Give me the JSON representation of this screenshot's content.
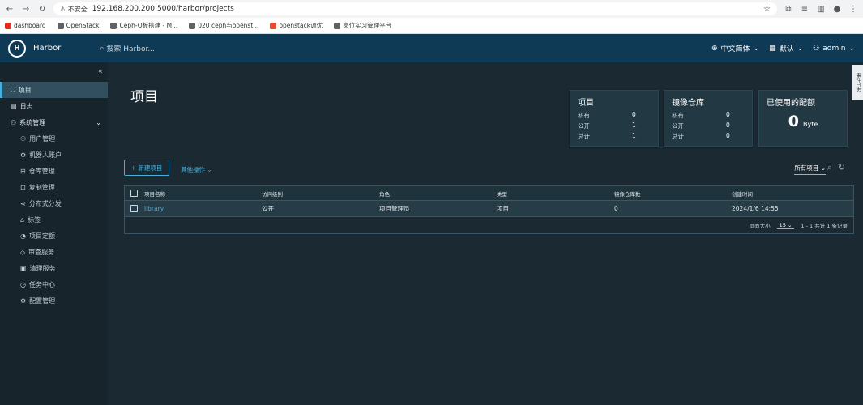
{
  "browser": {
    "security_label": "不安全",
    "url": "192.168.200.200:5000/harbor/projects",
    "bookmarks": [
      {
        "label": "dashboard",
        "color": "#d93025"
      },
      {
        "label": "OpenStack",
        "color": "#5f6368"
      },
      {
        "label": "Ceph-O板搭建 - M...",
        "color": "#5f6368"
      },
      {
        "label": "020 ceph与openst...",
        "color": "#5f6368"
      },
      {
        "label": "openstack调优",
        "color": "#e34a2f"
      },
      {
        "label": "岗位实习管理平台",
        "color": "#5f6368"
      }
    ]
  },
  "header": {
    "logo_glyph": "H",
    "brand": "Harbor",
    "search_placeholder": "搜索 Harbor...",
    "language": "中文简体",
    "theme": "默认",
    "user": "admin"
  },
  "sidebar": {
    "collapse_icon": "«",
    "items": [
      {
        "label": "项目",
        "icon": "⛶"
      },
      {
        "label": "日志",
        "icon": "▤"
      },
      {
        "label": "系统管理",
        "icon": "⚇"
      }
    ],
    "admin_items": [
      {
        "label": "用户管理",
        "icon": "⚇"
      },
      {
        "label": "机器人账户",
        "icon": "⚙"
      },
      {
        "label": "仓库管理",
        "icon": "⊞"
      },
      {
        "label": "复制管理",
        "icon": "⊡"
      },
      {
        "label": "分布式分发",
        "icon": "⋖"
      },
      {
        "label": "标签",
        "icon": "⌂"
      },
      {
        "label": "项目定额",
        "icon": "◔"
      },
      {
        "label": "审查服务",
        "icon": "◇"
      },
      {
        "label": "清理服务",
        "icon": "▣"
      },
      {
        "label": "任务中心",
        "icon": "◷"
      },
      {
        "label": "配置管理",
        "icon": "⚙"
      }
    ]
  },
  "page": {
    "title": "项目"
  },
  "cards": {
    "projects": {
      "title": "项目",
      "rows": [
        {
          "label": "私有",
          "value": "0"
        },
        {
          "label": "公开",
          "value": "1"
        },
        {
          "label": "总计",
          "value": "1"
        }
      ]
    },
    "repos": {
      "title": "镜像仓库",
      "rows": [
        {
          "label": "私有",
          "value": "0"
        },
        {
          "label": "公开",
          "value": "0"
        },
        {
          "label": "总计",
          "value": "0"
        }
      ]
    },
    "quota": {
      "title": "已使用的配额",
      "value": "0",
      "unit": "Byte"
    }
  },
  "toolbar": {
    "new_project": "+ 新建项目",
    "other_ops": "其他操作",
    "filter": "所有项目"
  },
  "table": {
    "headers": [
      "项目名称",
      "访问级别",
      "角色",
      "类型",
      "镜像仓库数",
      "创建时间"
    ],
    "rows": [
      [
        "library",
        "公开",
        "项目管理员",
        "项目",
        "0",
        "2024/1/6 14:55"
      ]
    ],
    "footer": {
      "page_size_label": "页面大小",
      "page_size": "15",
      "summary": "1 - 1 共计 1 条记录"
    }
  },
  "side_tab": "事件日志"
}
